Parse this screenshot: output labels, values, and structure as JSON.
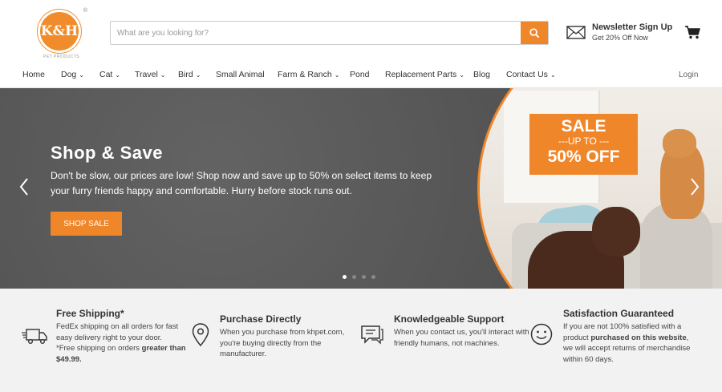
{
  "logo": {
    "text": "K&H",
    "reg": "®",
    "subtext": "PET PRODUCTS"
  },
  "search": {
    "placeholder": "What are you looking for?"
  },
  "newsletter": {
    "title": "Newsletter Sign Up",
    "subtitle": "Get 20% Off Now"
  },
  "nav": {
    "items": [
      {
        "label": "Home"
      },
      {
        "label": "Dog",
        "chev": "⌄"
      },
      {
        "label": "Cat",
        "chev": "⌄"
      },
      {
        "label": "Travel",
        "chev": "⌄"
      },
      {
        "label": "Bird",
        "chev": "⌄"
      },
      {
        "label": "Small Animal"
      },
      {
        "label": "Farm & Ranch",
        "chev": "⌄"
      },
      {
        "label": "Pond"
      },
      {
        "label": "Replacement Parts",
        "chev": "⌄"
      },
      {
        "label": "Blog"
      },
      {
        "label": "Contact Us",
        "chev": "⌄"
      }
    ],
    "login": "Login"
  },
  "hero": {
    "title": "Shop & Save",
    "text": "Don't be slow, our prices are low! Shop now and save up to 50% on select items to keep your furry friends happy and comfortable. Hurry before stock runs out.",
    "button": "SHOP SALE",
    "promo": {
      "line1": "SALE",
      "line2": "---UP TO ---",
      "line3": "50% OFF"
    },
    "slides": 4,
    "active_slide": 1
  },
  "features": [
    {
      "title": "Free Shipping*",
      "line1": "FedEx shipping on all orders for fast easy delivery right to your door.",
      "line2a": "*Free shipping on orders ",
      "line2b": "greater than $49.99."
    },
    {
      "title": "Purchase Directly",
      "line1": "When you purchase from khpet.com, you're buying directly from the manufacturer."
    },
    {
      "title": "Knowledgeable Support",
      "line1": "When you contact us, you'll interact with friendly humans, not machines."
    },
    {
      "title": "Satisfaction Guaranteed",
      "line1a": "If you are not 100% satisfied with a product ",
      "line1b": "purchased on this website",
      "line1c": ", we will accept returns of merchandise within 60 days."
    }
  ],
  "colors": {
    "accent": "#f0862a",
    "hero_bg": "#595959",
    "features_bg": "#f2f2f2"
  }
}
